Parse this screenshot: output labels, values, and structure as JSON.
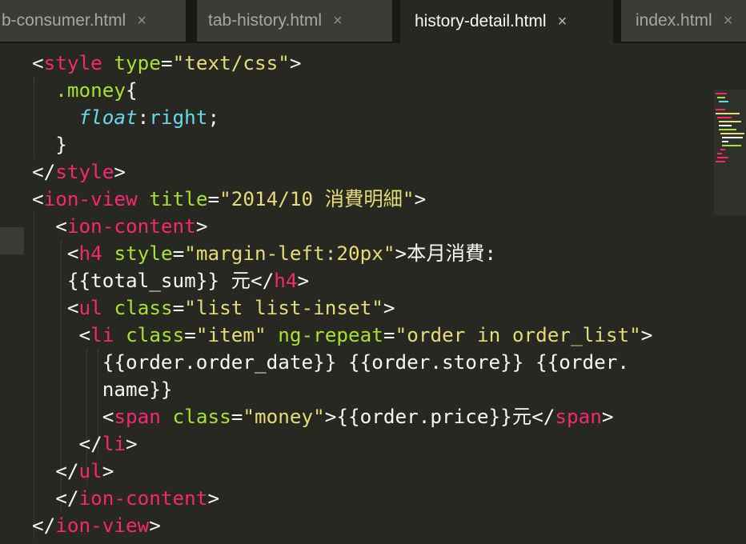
{
  "tabs": [
    {
      "label": "b-consumer.html",
      "close": "×",
      "active": false
    },
    {
      "label": "tab-history.html",
      "close": "×",
      "active": false
    },
    {
      "label": "history-detail.html",
      "close": "×",
      "active": true
    },
    {
      "label": "index.html",
      "close": "×",
      "active": false
    }
  ],
  "code_lines": [
    "<style type=\"text/css\">",
    "  .money{",
    "    float:right;",
    "  }",
    "</style>",
    "<ion-view title=\"2014/10 消費明細\">",
    "  <ion-content>",
    "   <h4 style=\"margin-left:20px\">本月消費:",
    "   {{total_sum}} 元</h4>",
    "   <ul class=\"list list-inset\">",
    "    <li class=\"item\" ng-repeat=\"order in order_list\">",
    "      {{order.order_date}} {{order.store}} {{order.",
    "      name}}",
    "      <span class=\"money\">{{order.price}}元</span>",
    "    </li>",
    "  </ul>",
    "  </ion-content>",
    "</ion-view>"
  ],
  "colors": {
    "background": "#272822",
    "tag": "#f92672",
    "attribute": "#a6e22e",
    "string": "#e6db74",
    "property": "#66d9ef",
    "text": "#f8f8f2"
  }
}
